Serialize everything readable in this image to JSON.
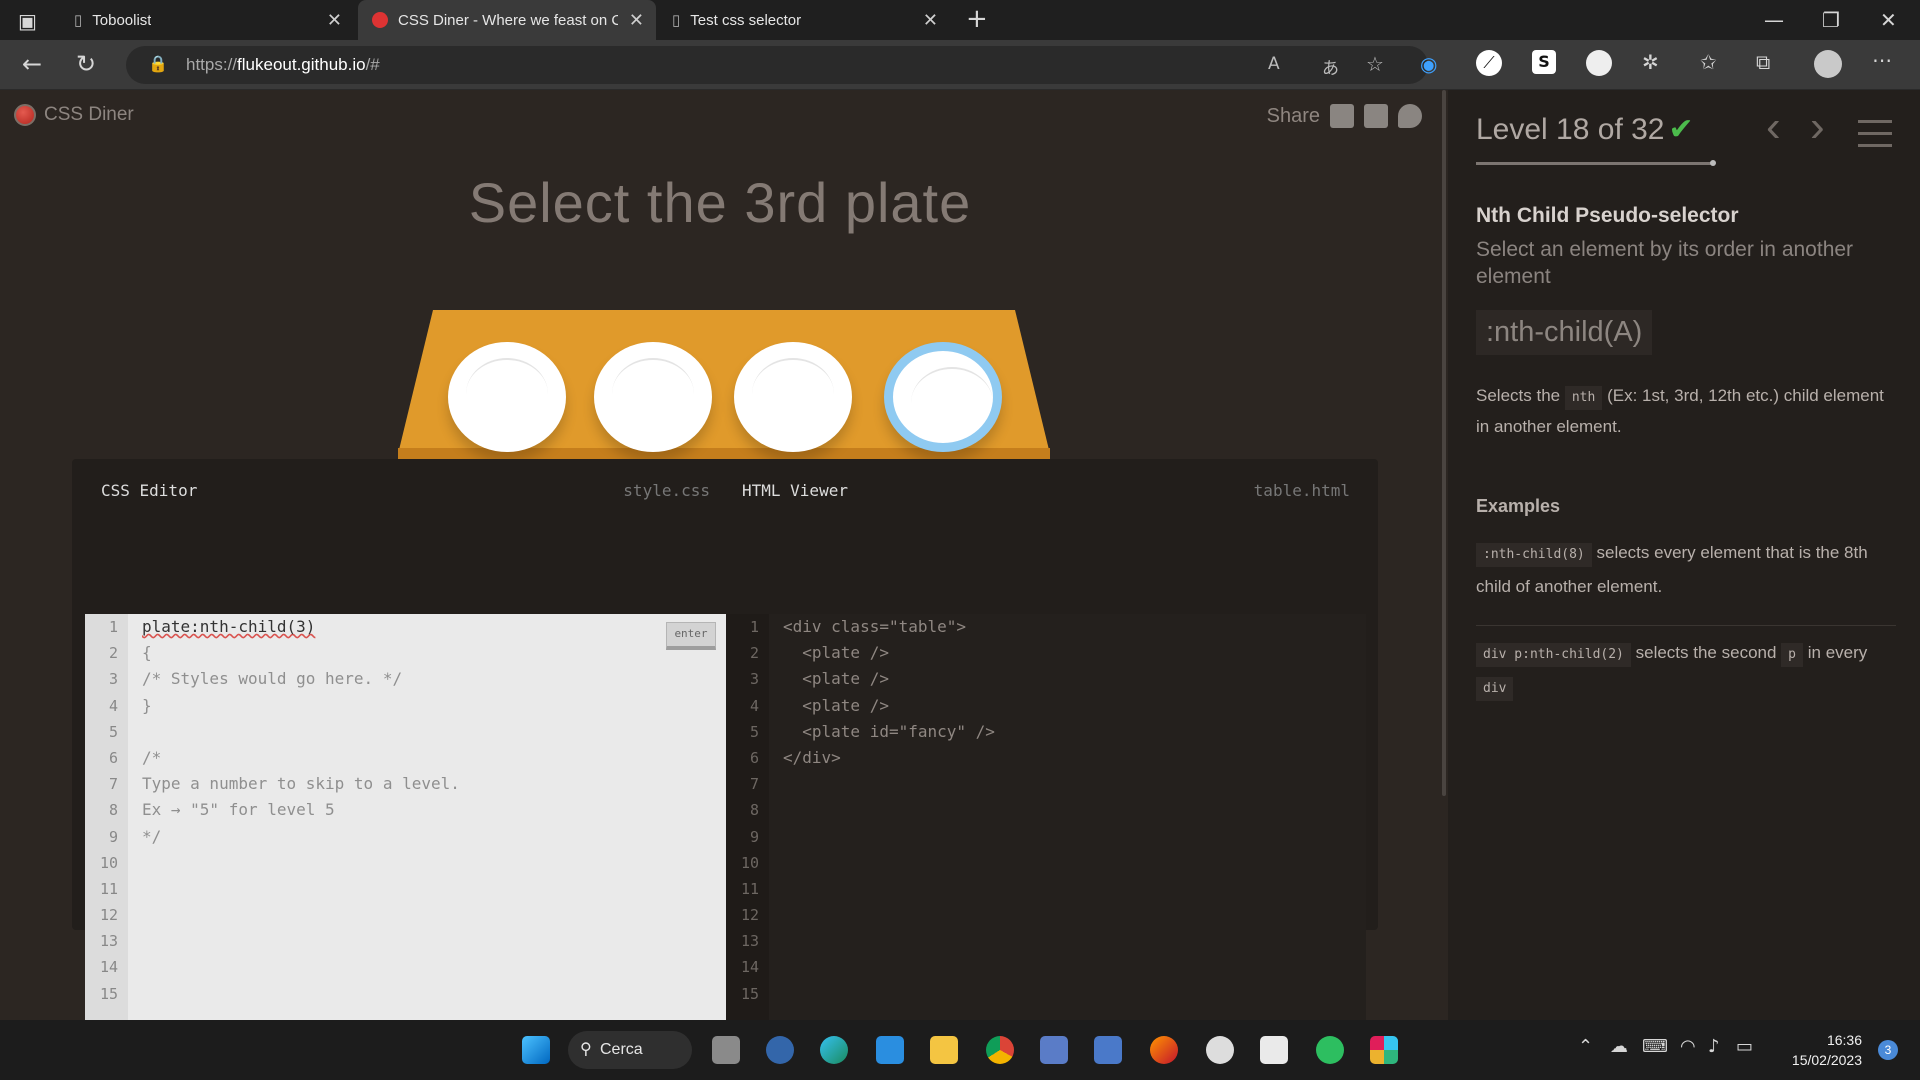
{
  "browser": {
    "tabs": [
      {
        "label": "Toboolist",
        "active": false
      },
      {
        "label": "CSS Diner - Where we feast on C",
        "active": true
      },
      {
        "label": "Test css selector",
        "active": false
      }
    ],
    "new_tab": "+",
    "url_prefix": "https://",
    "url_host": "flukeout.github.io",
    "url_path": "/#"
  },
  "page": {
    "brand": "CSS Diner",
    "share_label": "Share",
    "instruction": "Select the 3rd plate",
    "css_editor": {
      "label": "CSS Editor",
      "filename": "style.css",
      "enter_label": "enter",
      "lines": [
        "plate:nth-child(3)",
        "{",
        "/* Styles would go here. */",
        "}",
        "",
        "/*",
        "Type a number to skip to a level.",
        "Ex → \"5\" for level 5",
        "*/",
        "",
        "",
        "",
        "",
        "",
        ""
      ]
    },
    "html_viewer": {
      "label": "HTML Viewer",
      "filename": "table.html",
      "lines": [
        "<div class=\"table\">",
        "  <plate />",
        "  <plate />",
        "  <plate />",
        "  <plate id=\"fancy\" />",
        "</div>",
        "",
        "",
        "",
        "",
        "",
        "",
        "",
        "",
        ""
      ]
    },
    "line_numbers": [
      "1",
      "2",
      "3",
      "4",
      "5",
      "6",
      "7",
      "8",
      "9",
      "10",
      "11",
      "12",
      "13",
      "14",
      "15"
    ]
  },
  "sidebar": {
    "level_text": "Level 18 of 32",
    "check": "✔",
    "prev": "‹",
    "next": "›",
    "heading": "Nth Child Pseudo-selector",
    "subheading": "Select an element by its order in another element",
    "syntax": ":nth-child(A)",
    "desc_pre": "Selects the",
    "desc_tag": "nth",
    "desc_post": "(Ex: 1st, 3rd, 12th etc.) child element in another element.",
    "examples_label": "Examples",
    "ex1_tag": ":nth-child(8)",
    "ex1_text": "selects every element that is the 8th child of another element.",
    "ex2_tag": "div p:nth-child(2)",
    "ex2_text": "selects the second",
    "ex2_tag2": "p",
    "ex2_text2": "in every",
    "ex2_tag3": "div"
  },
  "taskbar": {
    "search_label": "Cerca",
    "time": "16:36",
    "date": "15/02/2023",
    "notifications": "3"
  },
  "colors": {
    "accent_blue": "#8fcaf1",
    "table_orange": "#e09a2b",
    "check_green": "#4cbb4c"
  }
}
